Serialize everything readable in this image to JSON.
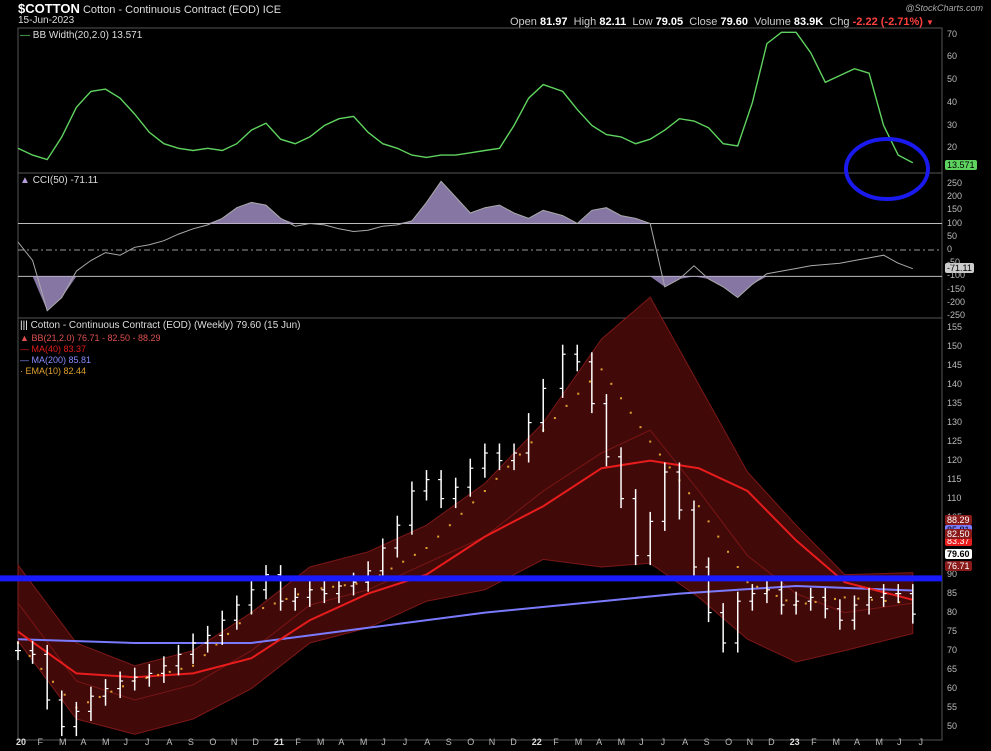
{
  "header": {
    "symbol": "$COTTON",
    "name": "Cotton - Continuous Contract (EOD)",
    "exchange": "ICE",
    "date": "15-Jun-2023",
    "watermark": "@StockCharts.com",
    "open_label": "Open",
    "open": "81.97",
    "high_label": "High",
    "high": "82.11",
    "low_label": "Low",
    "low": "79.05",
    "close_label": "Close",
    "close": "79.60",
    "volume_label": "Volume",
    "volume": "83.9K",
    "chg_label": "Chg",
    "chg": "-2.22 (-2.71%)"
  },
  "panels": {
    "bbw_label": "BB Width(20,2.0) 13.571",
    "bbw_tag": "13.571",
    "cci_label": "CCI(50) -71.11",
    "cci_tag": "-71.11",
    "price_label": "Cotton - Continuous Contract (EOD) (Weekly) 79.60 (15 Jun)",
    "legend": {
      "bb": "BB(21,2.0) 76.71 - 82.50 - 88.29",
      "ma40": "MA(40) 83.37",
      "ma200": "MA(200) 85.81",
      "ema10": "EMA(10) 82.44"
    },
    "price_tags": [
      "88.29",
      "85.81",
      "83.37",
      "82.50",
      "79.60",
      "76.71"
    ]
  },
  "colors": {
    "bg": "#000000",
    "bbw_line": "#5fd35f",
    "cci_fill": "#b39ddb",
    "bb_band": "#4a0b0b",
    "bb_edge": "#8a1a1a",
    "ma40": "#e81c1c",
    "ma200": "#7a7aff",
    "ema10": "#e0a030",
    "hline": "#1a1aff",
    "circle": "#1a1aee",
    "bars": "#ffffff"
  },
  "chart_data": [
    {
      "type": "line",
      "title": "BB Width(20,2.0) 13.571",
      "ylim": [
        10,
        72
      ],
      "yticks": [
        20,
        30,
        40,
        50,
        60,
        70
      ],
      "x": [
        0,
        3,
        6,
        9,
        12,
        15,
        18,
        21,
        24,
        27,
        30,
        33,
        36,
        39,
        42,
        45,
        48,
        51,
        54,
        57,
        60,
        63,
        66,
        69,
        72,
        75,
        78,
        81,
        84,
        87,
        90,
        93,
        96,
        99,
        102,
        105,
        108,
        112,
        115,
        118,
        121,
        124,
        127,
        130,
        133,
        136,
        139,
        142,
        145,
        148,
        151,
        154,
        157,
        160,
        163,
        166,
        169,
        172,
        175,
        178,
        181,
        184
      ],
      "values": [
        20,
        17,
        15,
        25,
        38,
        45,
        46,
        42,
        35,
        27,
        22,
        20,
        19,
        20,
        19,
        22,
        28,
        31,
        24,
        22,
        25,
        30,
        33,
        34,
        27,
        22,
        20,
        17,
        16,
        17,
        17,
        18,
        19,
        20,
        30,
        42,
        48,
        45,
        37,
        30,
        26,
        25,
        22,
        24,
        28,
        33,
        32,
        29,
        22,
        21,
        40,
        66,
        71,
        71,
        62,
        49,
        52,
        55,
        53,
        30,
        17,
        13.6
      ],
      "annotation": "circle"
    },
    {
      "type": "area",
      "title": "CCI(50) -71.11",
      "ylim": [
        -250,
        280
      ],
      "yticks": [
        250,
        200,
        150,
        100,
        50,
        0,
        -50,
        -100,
        -150,
        -200,
        -250
      ],
      "x": [
        0,
        3,
        6,
        9,
        12,
        15,
        18,
        21,
        24,
        27,
        30,
        33,
        36,
        39,
        42,
        45,
        48,
        51,
        54,
        57,
        60,
        63,
        66,
        69,
        72,
        75,
        78,
        81,
        84,
        87,
        90,
        93,
        96,
        99,
        102,
        105,
        108,
        112,
        115,
        118,
        121,
        124,
        127,
        130,
        133,
        136,
        139,
        142,
        145,
        148,
        151,
        154,
        157,
        160,
        163,
        166,
        169,
        172,
        175,
        178,
        181,
        184
      ],
      "values": [
        30,
        -40,
        -230,
        -180,
        -80,
        -40,
        -10,
        -20,
        10,
        20,
        35,
        60,
        80,
        95,
        120,
        160,
        180,
        170,
        120,
        90,
        100,
        95,
        80,
        70,
        75,
        90,
        95,
        110,
        180,
        260,
        200,
        140,
        160,
        170,
        140,
        120,
        150,
        130,
        100,
        150,
        160,
        130,
        120,
        100,
        -140,
        -110,
        -60,
        -110,
        -140,
        -180,
        -130,
        -90,
        -80,
        -70,
        -60,
        -55,
        -50,
        -40,
        -30,
        -20,
        -50,
        -71
      ]
    },
    {
      "type": "line",
      "title": "Cotton - Continuous Contract (EOD) (Weekly) 79.60 (15 Jun)",
      "ylim": [
        47,
        157
      ],
      "yticks": [
        50,
        55,
        60,
        65,
        70,
        75,
        80,
        85,
        90,
        95,
        100,
        105,
        110,
        115,
        120,
        125,
        130,
        135,
        140,
        145,
        150,
        155
      ],
      "xticks": [
        "20",
        "F",
        "M",
        "A",
        "M",
        "J",
        "J",
        "A",
        "S",
        "O",
        "N",
        "D",
        "21",
        "F",
        "M",
        "A",
        "M",
        "J",
        "J",
        "A",
        "S",
        "O",
        "N",
        "D",
        "22",
        "F",
        "M",
        "A",
        "M",
        "J",
        "J",
        "A",
        "S",
        "O",
        "N",
        "D",
        "23",
        "F",
        "M",
        "A",
        "M",
        "J",
        "J"
      ],
      "series": [
        {
          "name": "Cotton - Continuous Contract (EOD)",
          "x": [
            0,
            3,
            6,
            9,
            12,
            15,
            18,
            21,
            24,
            27,
            30,
            33,
            36,
            39,
            42,
            45,
            48,
            51,
            54,
            57,
            60,
            63,
            66,
            69,
            72,
            75,
            78,
            81,
            84,
            87,
            90,
            93,
            96,
            99,
            102,
            105,
            108,
            112,
            115,
            118,
            121,
            124,
            127,
            130,
            133,
            136,
            139,
            142,
            145,
            148,
            151,
            154,
            157,
            160,
            163,
            166,
            169,
            172,
            175,
            178,
            181,
            184
          ],
          "values": [
            70,
            69,
            57,
            50,
            54,
            58,
            60,
            62,
            63,
            64,
            66,
            69,
            72,
            74,
            78,
            82,
            86,
            90,
            83,
            84,
            86,
            85,
            87,
            88,
            91,
            97,
            103,
            112,
            115,
            110,
            113,
            118,
            122,
            120,
            122,
            130,
            139,
            148,
            146,
            135,
            121,
            110,
            95,
            104,
            117,
            107,
            92,
            80,
            72,
            83,
            85,
            86,
            82,
            83,
            84,
            81,
            78,
            82,
            84,
            85,
            85,
            79.6
          ]
        },
        {
          "name": "BB(21,2.0)",
          "x": [
            0,
            12,
            24,
            36,
            48,
            60,
            72,
            84,
            96,
            108,
            120,
            130,
            140,
            150,
            160,
            170,
            184
          ],
          "values": [
            82.5,
            62,
            57,
            61,
            70,
            82,
            86,
            93,
            100,
            112,
            122,
            128,
            112,
            95,
            85,
            80,
            82.5
          ]
        },
        {
          "name": "MA(40)",
          "x": [
            0,
            12,
            24,
            36,
            48,
            60,
            72,
            84,
            96,
            108,
            120,
            130,
            140,
            150,
            160,
            170,
            184
          ],
          "values": [
            75,
            64,
            63,
            64,
            68,
            78,
            85,
            90,
            100,
            108,
            118,
            120,
            118,
            112,
            99,
            88,
            83.37
          ]
        },
        {
          "name": "MA(200)",
          "x": [
            0,
            24,
            48,
            72,
            96,
            120,
            136,
            160,
            184
          ],
          "values": [
            73,
            72,
            72,
            76,
            80,
            83,
            85,
            87,
            85.81
          ]
        },
        {
          "name": "EMA(10)",
          "x": [
            0,
            12,
            24,
            36,
            48,
            60,
            72,
            84,
            96,
            108,
            120,
            130,
            140,
            150,
            160,
            170,
            184
          ],
          "values": [
            72,
            55,
            62,
            66,
            80,
            86,
            88,
            97,
            112,
            128,
            144,
            125,
            108,
            88,
            82,
            84,
            82.44
          ]
        }
      ],
      "horizontal_line": 89
    }
  ]
}
